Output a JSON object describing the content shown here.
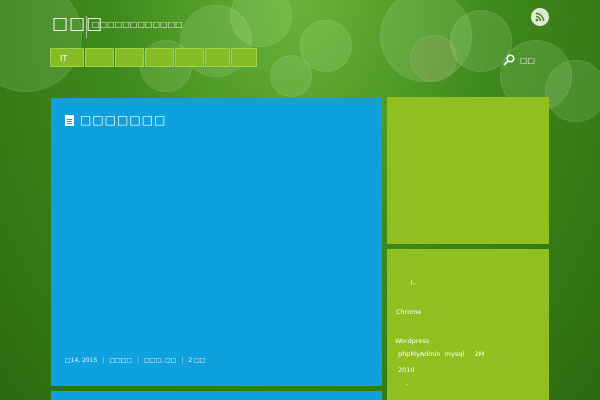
{
  "site": {
    "title": "□□□",
    "tagline": "□□□□□□□□□□□□"
  },
  "nav": {
    "items": [
      {
        "label": "IT"
      },
      {
        "label": ""
      },
      {
        "label": ""
      },
      {
        "label": ""
      },
      {
        "label": ""
      },
      {
        "label": ""
      },
      {
        "label": ""
      }
    ]
  },
  "search": {
    "label": "□□"
  },
  "post": {
    "title": "□□□□□□□",
    "date": "□14, 2015",
    "category": "□□□□",
    "tags": "□□□, □□",
    "comments": "2 □□"
  },
  "sidebar": {
    "lines": [
      "!–",
      "Chrome",
      "Wordpress",
      "phpMyAdmin  mysql     2M",
      "2010",
      "-"
    ]
  },
  "colors": {
    "background": "#2f6f12",
    "post_card": "#0ea1de",
    "sidebar_card": "#8fc01f",
    "nav_item": "#86bd27"
  }
}
